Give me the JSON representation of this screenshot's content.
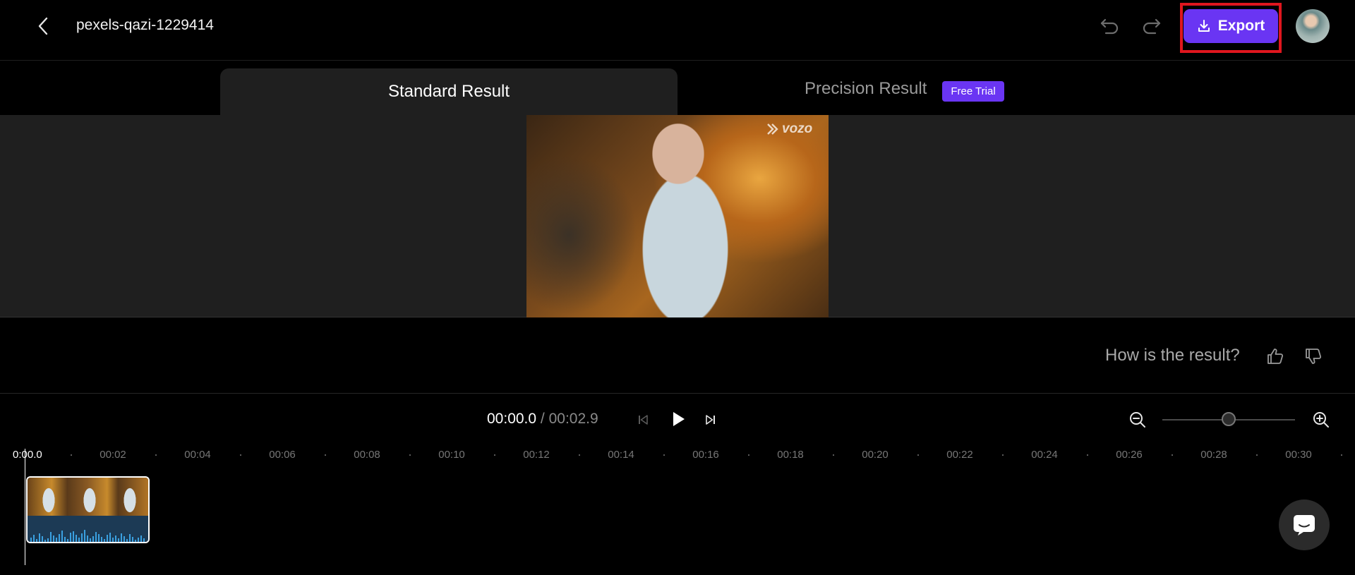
{
  "header": {
    "project_title": "pexels-qazi-1229414",
    "export_label": "Export"
  },
  "tabs": [
    {
      "label": "Standard Result",
      "active": true
    },
    {
      "label": "Precision Result",
      "active": false,
      "badge": "Free Trial"
    }
  ],
  "preview": {
    "watermark": "vozo"
  },
  "feedback": {
    "question": "How is the result?"
  },
  "playback": {
    "current_time": "00:00.0",
    "separator": " / ",
    "total_time": "00:02.9"
  },
  "timeline": {
    "start_label": "0:00.0",
    "ticks": [
      "00:02",
      "00:04",
      "00:06",
      "00:08",
      "00:10",
      "00:12",
      "00:14",
      "00:16",
      "00:18",
      "00:20",
      "00:22",
      "00:24",
      "00:26",
      "00:28",
      "00:30"
    ],
    "zoom_level": 0.5
  },
  "colors": {
    "accent": "#6a35f3",
    "highlight_outline": "#e0161e",
    "preview_bg": "#1f1f1f"
  },
  "icons": [
    "back-icon",
    "undo-icon",
    "redo-icon",
    "download-icon",
    "thumbs-up-icon",
    "thumbs-down-icon",
    "skip-previous-icon",
    "play-icon",
    "skip-next-icon",
    "zoom-out-icon",
    "zoom-in-icon",
    "chat-icon"
  ]
}
